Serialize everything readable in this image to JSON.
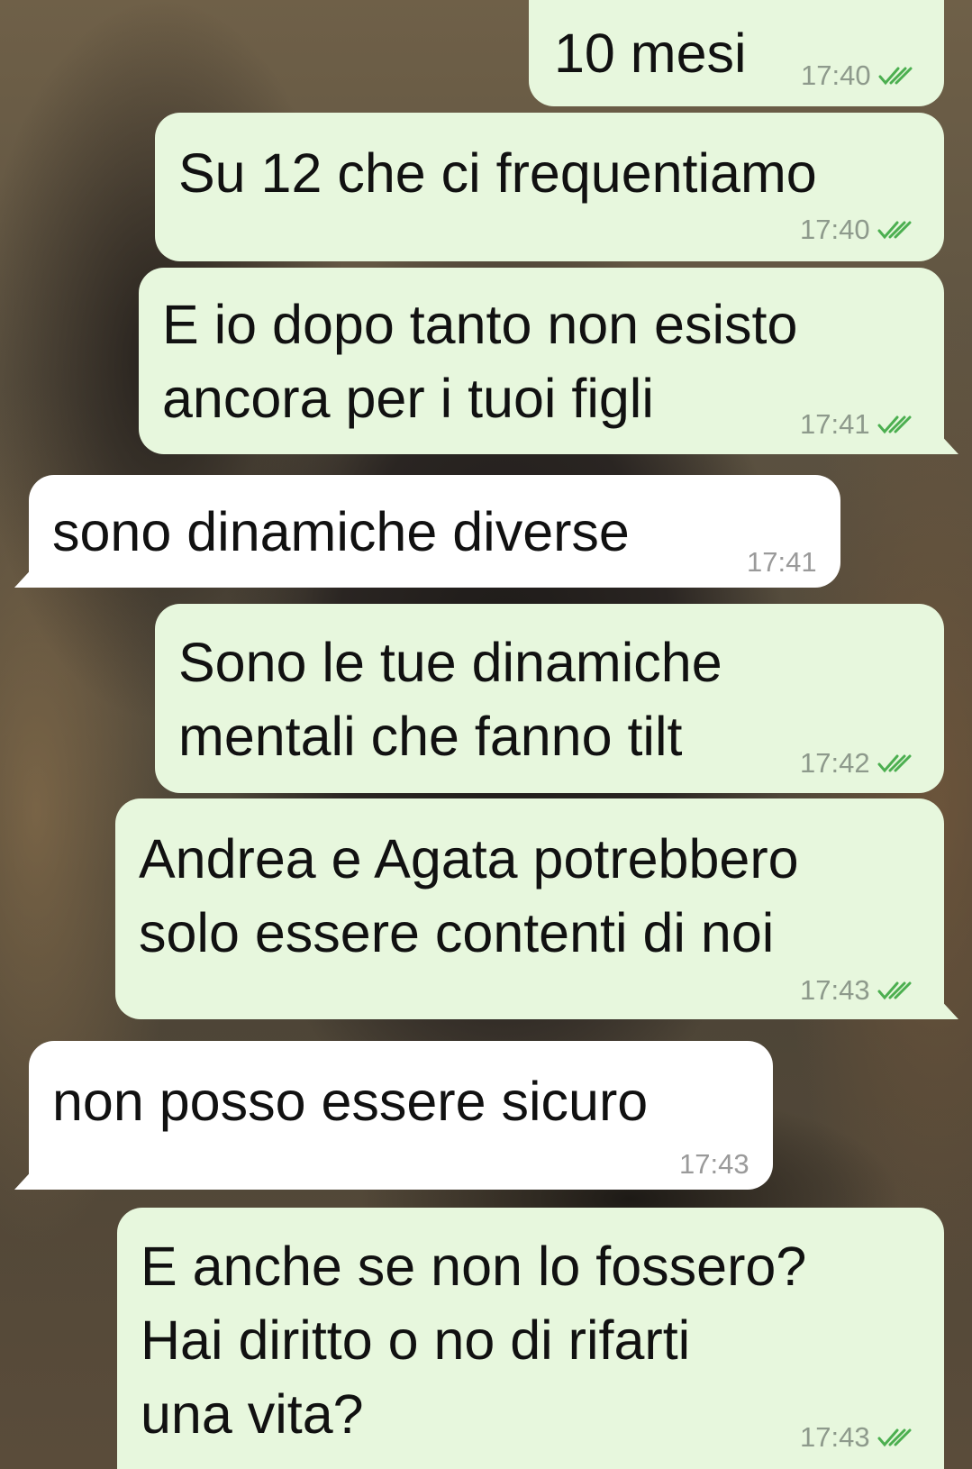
{
  "messages": [
    {
      "direction": "out",
      "lines": [
        "10 mesi"
      ],
      "time": "17:40",
      "status_icon": "double-check-icon"
    },
    {
      "direction": "out",
      "lines": [
        "Su 12 che ci frequentiamo"
      ],
      "time": "17:40",
      "status_icon": "double-check-icon"
    },
    {
      "direction": "out",
      "lines": [
        "E io dopo tanto non esisto",
        "ancora per i tuoi figli"
      ],
      "time": "17:41",
      "status_icon": "double-check-icon"
    },
    {
      "direction": "in",
      "lines": [
        "sono dinamiche diverse"
      ],
      "time": "17:41"
    },
    {
      "direction": "out",
      "lines": [
        "Sono le tue dinamiche",
        "mentali che fanno tilt"
      ],
      "time": "17:42",
      "status_icon": "double-check-icon"
    },
    {
      "direction": "out",
      "lines": [
        "Andrea e Agata potrebbero",
        "solo essere contenti di noi"
      ],
      "time": "17:43",
      "status_icon": "double-check-icon"
    },
    {
      "direction": "in",
      "lines": [
        "non posso essere sicuro"
      ],
      "time": "17:43"
    },
    {
      "direction": "out",
      "lines": [
        "E anche se non lo fossero?",
        "Hai diritto o no di rifarti",
        "una vita?"
      ],
      "time": "17:43",
      "status_icon": "double-check-icon"
    }
  ],
  "colors": {
    "outgoing_bubble": "#e7f7dd",
    "incoming_bubble": "#ffffff",
    "read_check": "#4caf50"
  }
}
